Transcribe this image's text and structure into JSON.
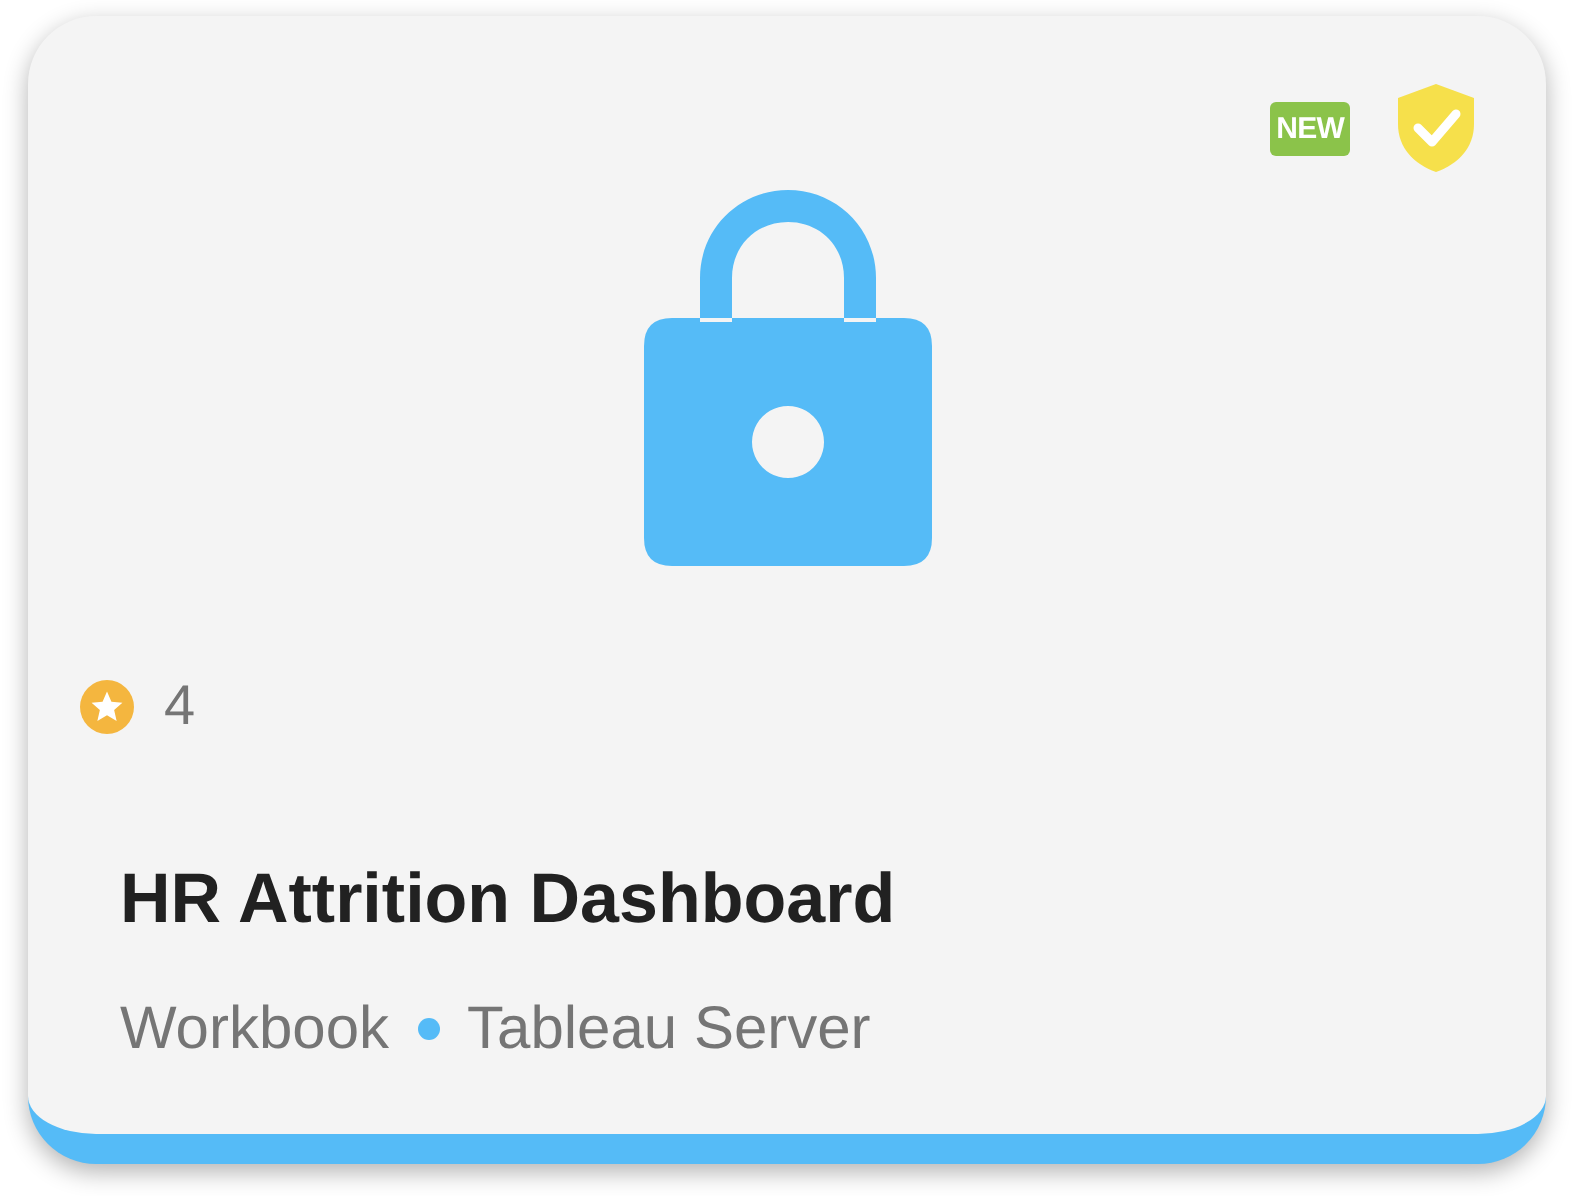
{
  "card": {
    "badge": "NEW",
    "certified": true,
    "favorites": "4",
    "title": "HR Attrition Dashboard",
    "type": "Workbook",
    "source": "Tableau Server"
  }
}
